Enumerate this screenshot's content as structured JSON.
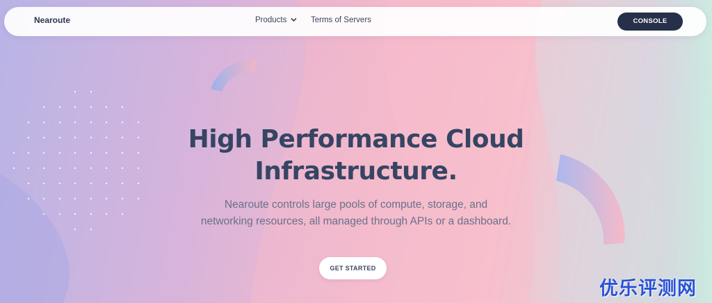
{
  "navbar": {
    "brand": "Nearoute",
    "items": [
      {
        "label": "Products",
        "has_dropdown": true
      },
      {
        "label": "Terms of Servers",
        "has_dropdown": false
      }
    ],
    "console_label": "CONSOLE"
  },
  "hero": {
    "title_line1": "High Performance Cloud",
    "title_line2": "Infrastructure.",
    "subtitle_line1": "Nearoute controls large pools of compute, storage, and",
    "subtitle_line2": "networking resources, all managed through APIs or a dashboard.",
    "cta_label": "GET STARTED"
  },
  "watermark": {
    "text": "优乐评测网"
  },
  "colors": {
    "title": "#364563",
    "subtitle": "#6c6f8a",
    "console_button": "#27304a",
    "watermark": "#2a52d6",
    "bg_left": "#b8b4e6",
    "bg_middle": "#f0b8cc",
    "bg_right": "#b9ecd9"
  },
  "icons": {
    "products_dropdown": "chevron-down-icon"
  }
}
